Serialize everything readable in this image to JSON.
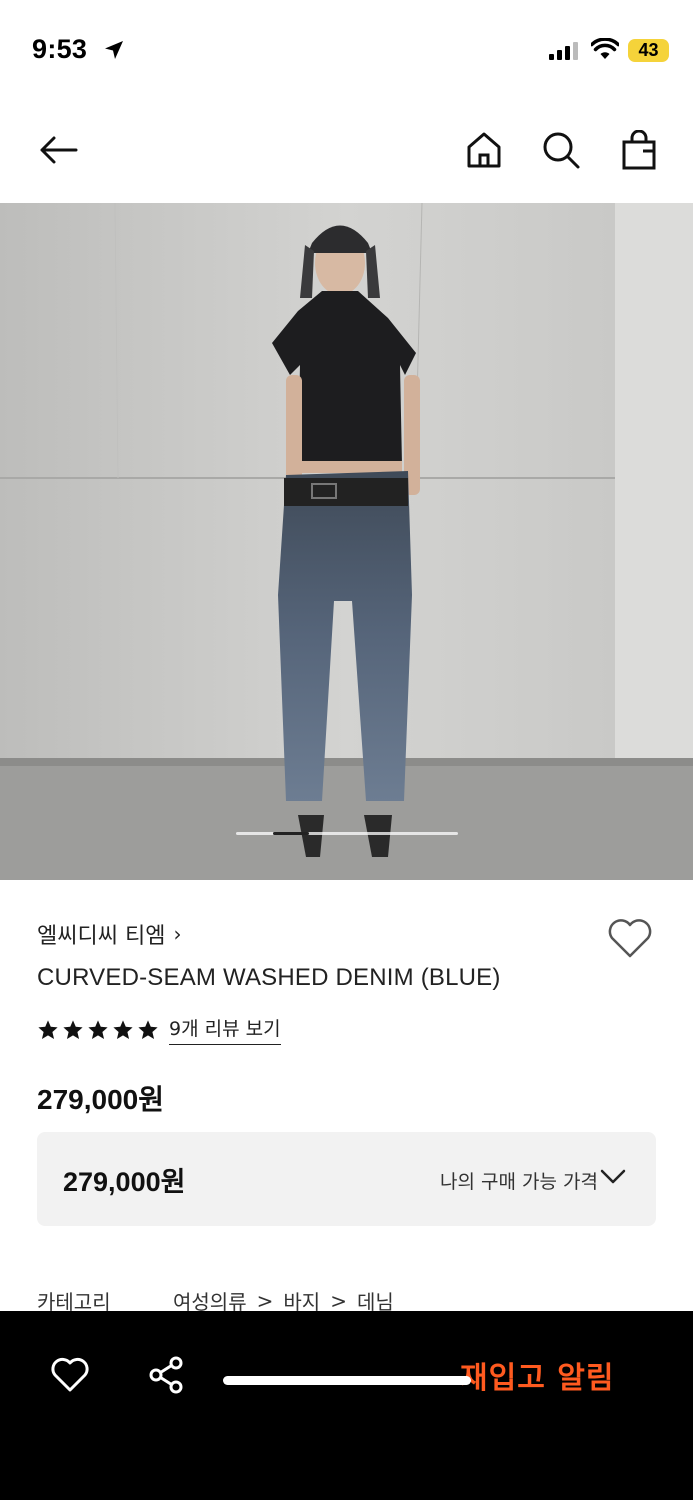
{
  "status_bar": {
    "time": "9:53",
    "battery": "43"
  },
  "header": {
    "back_icon": "arrow-left-icon",
    "home_icon": "home-icon",
    "search_icon": "search-icon",
    "bag_icon": "shopping-bag-icon"
  },
  "hero": {
    "image_alt": "Model wearing curved-seam washed denim"
  },
  "product": {
    "brand": "엘씨디씨 티엠",
    "brand_chevron": "›",
    "title": "CURVED-SEAM WASHED DENIM (BLUE)",
    "rating": 5,
    "review_link": "9개 리뷰 보기",
    "price": "279,000원"
  },
  "price_box": {
    "value": "279,000원",
    "label": "나의 구매 가능 가격"
  },
  "category": {
    "label": "카테고리",
    "path": [
      "여성의류",
      "바지",
      "데님"
    ],
    "separator": ">"
  },
  "bottom_bar": {
    "restock_label": "재입고 알림"
  },
  "colors": {
    "accent": "#ff5a1f",
    "bottom_bar_bg": "#000000",
    "battery": "#f5d33a"
  }
}
